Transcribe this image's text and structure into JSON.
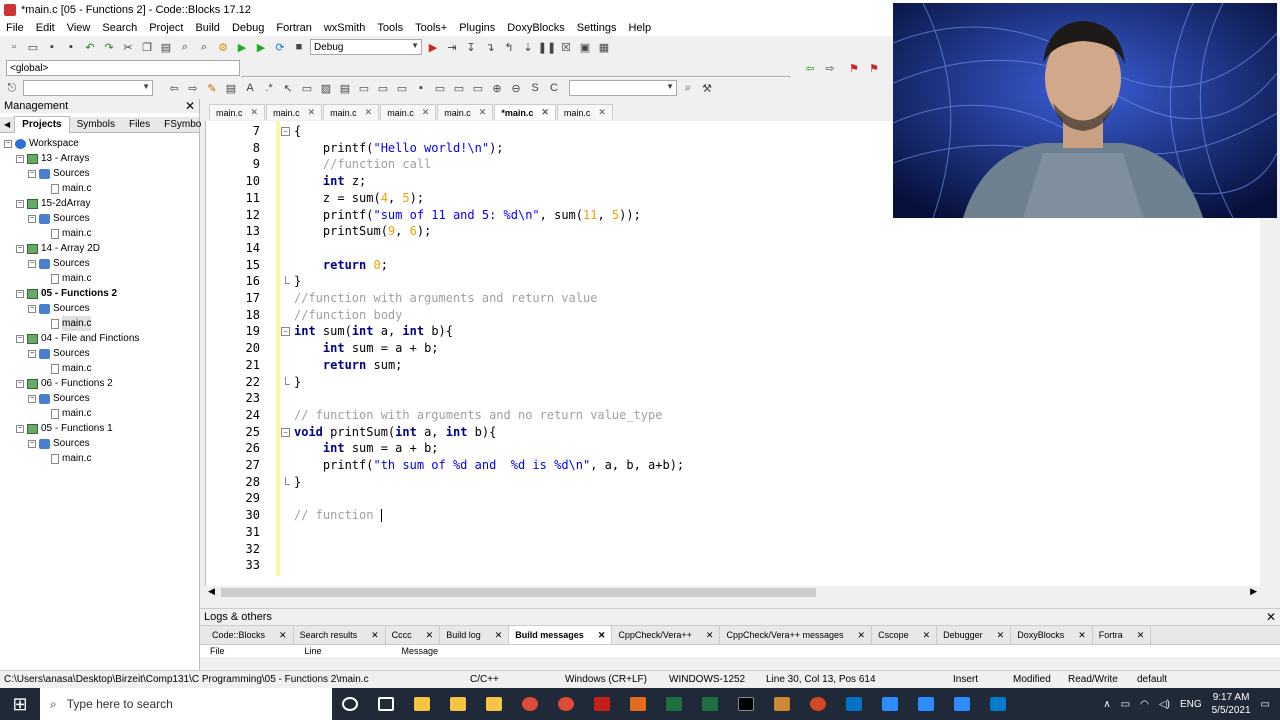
{
  "window": {
    "title": "*main.c [05 - Functions 2] - Code::Blocks 17.12"
  },
  "menu": [
    "File",
    "Edit",
    "View",
    "Search",
    "Project",
    "Build",
    "Debug",
    "Fortran",
    "wxSmith",
    "Tools",
    "Tools+",
    "Plugins",
    "DoxyBlocks",
    "Settings",
    "Help"
  ],
  "toolbar": {
    "build_target": "Debug",
    "scope": "<global>"
  },
  "management": {
    "title": "Management",
    "tabs": [
      "Projects",
      "Symbols",
      "Files",
      "FSymbo"
    ],
    "tree": [
      {
        "label": "Workspace",
        "level": 0,
        "kind": "ws"
      },
      {
        "label": "13 - Arrays",
        "level": 1,
        "kind": "proj"
      },
      {
        "label": "Sources",
        "level": 2,
        "kind": "src"
      },
      {
        "label": "main.c",
        "level": 3,
        "kind": "file"
      },
      {
        "label": "15-2dArray",
        "level": 1,
        "kind": "proj"
      },
      {
        "label": "Sources",
        "level": 2,
        "kind": "src"
      },
      {
        "label": "main.c",
        "level": 3,
        "kind": "file"
      },
      {
        "label": "14 - Array 2D",
        "level": 1,
        "kind": "proj"
      },
      {
        "label": "Sources",
        "level": 2,
        "kind": "src"
      },
      {
        "label": "main.c",
        "level": 3,
        "kind": "file"
      },
      {
        "label": "05 - Functions 2",
        "level": 1,
        "kind": "proj",
        "bold": true
      },
      {
        "label": "Sources",
        "level": 2,
        "kind": "src"
      },
      {
        "label": "main.c",
        "level": 3,
        "kind": "file",
        "selected": true
      },
      {
        "label": "04 - File and Finctions",
        "level": 1,
        "kind": "proj"
      },
      {
        "label": "Sources",
        "level": 2,
        "kind": "src"
      },
      {
        "label": "main.c",
        "level": 3,
        "kind": "file"
      },
      {
        "label": "06 - Functions 2",
        "level": 1,
        "kind": "proj"
      },
      {
        "label": "Sources",
        "level": 2,
        "kind": "src"
      },
      {
        "label": "main.c",
        "level": 3,
        "kind": "file"
      },
      {
        "label": "05 - Functions 1",
        "level": 1,
        "kind": "proj"
      },
      {
        "label": "Sources",
        "level": 2,
        "kind": "src"
      },
      {
        "label": "main.c",
        "level": 3,
        "kind": "file"
      }
    ]
  },
  "editor_tabs": [
    {
      "label": "main.c"
    },
    {
      "label": "main.c"
    },
    {
      "label": "main.c"
    },
    {
      "label": "main.c"
    },
    {
      "label": "main.c"
    },
    {
      "label": "*main.c",
      "active": true
    },
    {
      "label": "main.c"
    }
  ],
  "code_lines": [
    {
      "n": "7",
      "html": "{"
    },
    {
      "n": "8",
      "html": "    printf(<span class=str>\"Hello world!\\n\"</span>);"
    },
    {
      "n": "9",
      "html": "    <span class=cm>//function call</span>"
    },
    {
      "n": "10",
      "html": "    <span class=kw>int</span> z;"
    },
    {
      "n": "11",
      "html": "    z = sum(<span class=num>4</span>, <span class=num>5</span>);"
    },
    {
      "n": "12",
      "html": "    printf(<span class=str>\"sum of 11 and 5: %d\\n\"</span>, sum(<span class=num>11</span>, <span class=num>5</span>));"
    },
    {
      "n": "13",
      "html": "    printSum(<span class=num>9</span>, <span class=num>6</span>);"
    },
    {
      "n": "14",
      "html": ""
    },
    {
      "n": "15",
      "html": "    <span class=kw>return</span> <span class=num>0</span>;"
    },
    {
      "n": "16",
      "html": "}"
    },
    {
      "n": "17",
      "html": "<span class=cm>//function with arguments and return value</span>"
    },
    {
      "n": "18",
      "html": "<span class=cm>//function body</span>"
    },
    {
      "n": "19",
      "html": "<span class=kw>int</span> sum(<span class=kw>int</span> a, <span class=kw>int</span> b){"
    },
    {
      "n": "20",
      "html": "    <span class=kw>int</span> sum = a + b;"
    },
    {
      "n": "21",
      "html": "    <span class=kw>return</span> sum;"
    },
    {
      "n": "22",
      "html": "}"
    },
    {
      "n": "23",
      "html": ""
    },
    {
      "n": "24",
      "html": "<span class=cm>// function with arguments and no return value_type</span>"
    },
    {
      "n": "25",
      "html": "<span class=kw>void</span> printSum(<span class=kw>int</span> a, <span class=kw>int</span> b){"
    },
    {
      "n": "26",
      "html": "    <span class=kw>int</span> sum = a + b;"
    },
    {
      "n": "27",
      "html": "    printf(<span class=str>\"th sum of %d and  %d is %d\\n\"</span>, a, b, a+b);"
    },
    {
      "n": "28",
      "html": "}"
    },
    {
      "n": "29",
      "html": ""
    },
    {
      "n": "30",
      "html": "<span class=cm>// function </span><span class=caret></span>"
    },
    {
      "n": "31",
      "html": ""
    },
    {
      "n": "32",
      "html": ""
    },
    {
      "n": "33",
      "html": ""
    }
  ],
  "logs": {
    "title": "Logs & others",
    "tabs": [
      {
        "label": "Code::Blocks"
      },
      {
        "label": "Search results"
      },
      {
        "label": "Cccc"
      },
      {
        "label": "Build log"
      },
      {
        "label": "Build messages",
        "active": true
      },
      {
        "label": "CppCheck/Vera++"
      },
      {
        "label": "CppCheck/Vera++ messages"
      },
      {
        "label": "Cscope"
      },
      {
        "label": "Debugger"
      },
      {
        "label": "DoxyBlocks"
      },
      {
        "label": "Fortra"
      }
    ],
    "columns": [
      "File",
      "Line",
      "Message"
    ]
  },
  "status": {
    "path": "C:\\Users\\anasa\\Desktop\\Birzeit\\Comp131\\C Programming\\05 - Functions 2\\main.c",
    "lang": "C/C++",
    "eol": "Windows (CR+LF)",
    "enc": "WINDOWS-1252",
    "pos": "Line 30, Col 13, Pos 614",
    "mode": "Insert",
    "modified": "Modified",
    "rw": "Read/Write",
    "profile": "default"
  },
  "taskbar": {
    "search_placeholder": "Type here to search",
    "lang": "ENG",
    "time": "9:17 AM",
    "date": "5/5/2021"
  },
  "colors": {
    "keyword": "#00008b",
    "string": "#0000ff",
    "number": "#f0a000",
    "comment": "#a0a0a0",
    "taskbar": "#1f2937"
  }
}
